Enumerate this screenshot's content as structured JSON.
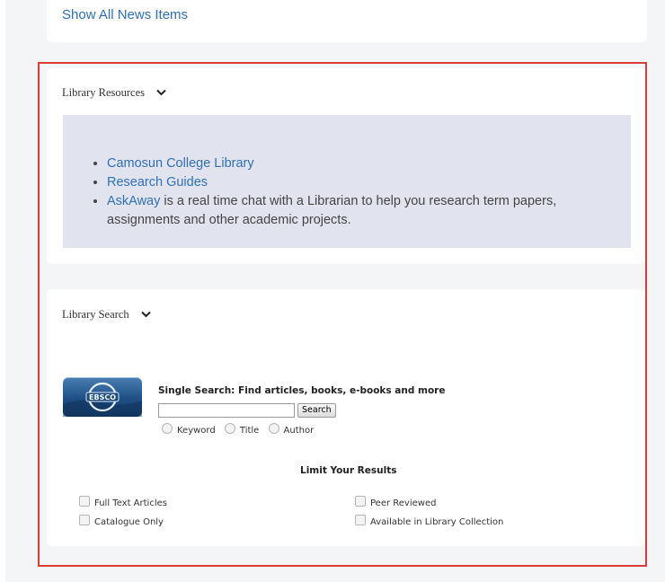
{
  "news": {
    "show_all_label": "Show All News Items"
  },
  "resources": {
    "title": "Library Resources",
    "items": [
      {
        "link": "Camosun College Library",
        "text": ""
      },
      {
        "link": "Research Guides",
        "text": ""
      },
      {
        "link": "AskAway",
        "text": " is a real time chat with a Librarian to help you research term papers, assignments and other academic projects."
      }
    ]
  },
  "search": {
    "title": "Library Search",
    "logo_text": "EBSCO",
    "single_search_title": "Single Search: Find articles, books, e-books and more",
    "input_value": "",
    "search_button": "Search",
    "radio_options": [
      "Keyword",
      "Title",
      "Author"
    ],
    "limit_title": "Limit Your Results",
    "limits": [
      "Full Text Articles",
      "Peer Reviewed",
      "Catalogue Only",
      "Available in Library Collection"
    ]
  },
  "colors": {
    "link": "#2f6fb6",
    "highlight_border": "#dc3b3b",
    "resource_box": "#e1e4ef",
    "page_background": "#f4f5f7"
  }
}
